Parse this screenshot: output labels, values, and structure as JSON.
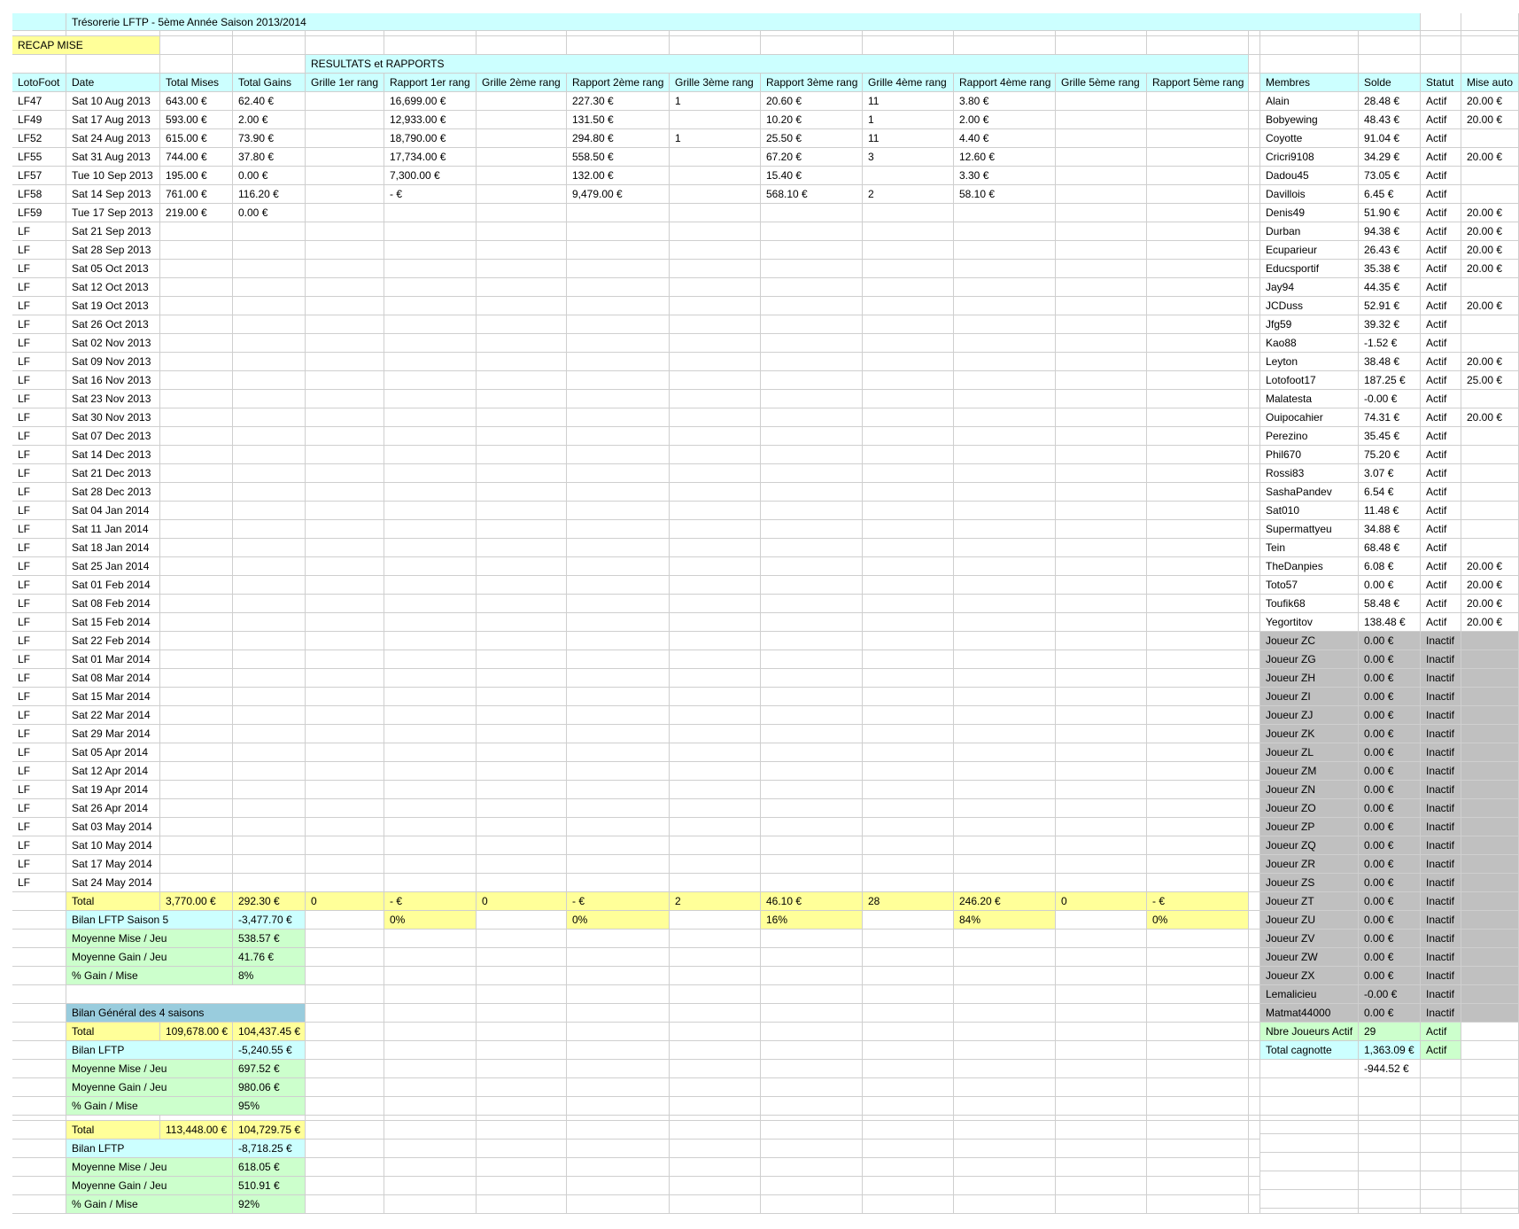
{
  "colors": {
    "cyan": "#ccffff",
    "yellow": "#ffff99",
    "green": "#ccffcc",
    "blue": "#99ccdd",
    "gray": "#c0c0c0",
    "white": "#ffffff",
    "grid": "#cfcfcf"
  },
  "title": "Trésorerie LFTP - 5ème Année Saison 2013/2014",
  "recap_label": "RECAP MISE",
  "results_label": "RESULTATS et RAPPORTS",
  "left_headers": [
    "LotoFoot",
    "Date",
    "Total Mises",
    "Total Gains",
    "Grille 1er rang",
    "Rapport 1er rang",
    "Grille 2ème rang",
    "Rapport 2ème rang",
    "Grille 3ème rang",
    "Rapport 3ème rang",
    "Grille 4ème rang",
    "Rapport 4ème rang",
    "Grille 5ème rang",
    "Rapport 5ème rang"
  ],
  "member_headers": [
    "Membres",
    "Solde",
    "Statut",
    "Mise auto"
  ],
  "games": [
    [
      "LF47",
      "Sat 10 Aug 2013",
      "643.00 €",
      "62.40 €",
      "",
      "16,699.00 €",
      "",
      "227.30 €",
      "1",
      "20.60 €",
      "11",
      "3.80 €",
      "",
      ""
    ],
    [
      "LF49",
      "Sat 17 Aug 2013",
      "593.00 €",
      "2.00 €",
      "",
      "12,933.00 €",
      "",
      "131.50 €",
      "",
      "10.20 €",
      "1",
      "2.00 €",
      "",
      ""
    ],
    [
      "LF52",
      "Sat 24 Aug 2013",
      "615.00 €",
      "73.90 €",
      "",
      "18,790.00 €",
      "",
      "294.80 €",
      "1",
      "25.50 €",
      "11",
      "4.40 €",
      "",
      ""
    ],
    [
      "LF55",
      "Sat 31 Aug 2013",
      "744.00 €",
      "37.80 €",
      "",
      "17,734.00 €",
      "",
      "558.50 €",
      "",
      "67.20 €",
      "3",
      "12.60 €",
      "",
      ""
    ],
    [
      "LF57",
      "Tue 10 Sep 2013",
      "195.00 €",
      "0.00 €",
      "",
      "7,300.00 €",
      "",
      "132.00 €",
      "",
      "15.40 €",
      "",
      "3.30 €",
      "",
      ""
    ],
    [
      "LF58",
      "Sat 14 Sep 2013",
      "761.00 €",
      "116.20 €",
      "",
      "- €",
      "",
      "9,479.00 €",
      "",
      "568.10 €",
      "2",
      "58.10 €",
      "",
      ""
    ],
    [
      "LF59",
      "Tue 17 Sep 2013",
      "219.00 €",
      "0.00 €",
      "",
      "",
      "",
      "",
      "",
      "",
      "",
      "",
      "",
      ""
    ],
    [
      "LF",
      "Sat 21 Sep 2013"
    ],
    [
      "LF",
      "Sat 28 Sep 2013"
    ],
    [
      "LF",
      "Sat 05 Oct 2013"
    ],
    [
      "LF",
      "Sat 12 Oct 2013"
    ],
    [
      "LF",
      "Sat 19 Oct 2013"
    ],
    [
      "LF",
      "Sat 26 Oct 2013"
    ],
    [
      "LF",
      "Sat 02 Nov 2013"
    ],
    [
      "LF",
      "Sat 09 Nov 2013"
    ],
    [
      "LF",
      "Sat 16 Nov 2013"
    ],
    [
      "LF",
      "Sat 23 Nov 2013"
    ],
    [
      "LF",
      "Sat 30 Nov 2013"
    ],
    [
      "LF",
      "Sat 07 Dec 2013"
    ],
    [
      "LF",
      "Sat 14 Dec 2013"
    ],
    [
      "LF",
      "Sat 21 Dec 2013"
    ],
    [
      "LF",
      "Sat 28 Dec 2013"
    ],
    [
      "LF",
      "Sat 04 Jan 2014"
    ],
    [
      "LF",
      "Sat 11 Jan 2014"
    ],
    [
      "LF",
      "Sat 18 Jan 2014"
    ],
    [
      "LF",
      "Sat 25 Jan 2014"
    ],
    [
      "LF",
      "Sat 01 Feb 2014"
    ],
    [
      "LF",
      "Sat 08 Feb 2014"
    ],
    [
      "LF",
      "Sat 15 Feb 2014"
    ],
    [
      "LF",
      "Sat 22 Feb 2014"
    ],
    [
      "LF",
      "Sat 01 Mar 2014"
    ],
    [
      "LF",
      "Sat 08 Mar 2014"
    ],
    [
      "LF",
      "Sat 15 Mar 2014"
    ],
    [
      "LF",
      "Sat 22 Mar 2014"
    ],
    [
      "LF",
      "Sat 29 Mar 2014"
    ],
    [
      "LF",
      "Sat 05 Apr 2014"
    ],
    [
      "LF",
      "Sat 12 Apr 2014"
    ],
    [
      "LF",
      "Sat 19 Apr 2014"
    ],
    [
      "LF",
      "Sat 26 Apr 2014"
    ],
    [
      "LF",
      "Sat 03 May 2014"
    ],
    [
      "LF",
      "Sat 10 May 2014"
    ],
    [
      "LF",
      "Sat 17 May 2014"
    ],
    [
      "LF",
      "Sat 24 May 2014"
    ]
  ],
  "total_row": [
    "",
    "Total",
    "3,770.00 €",
    "292.30 €",
    "0",
    "- €",
    "0",
    "- €",
    "2",
    "46.10 €",
    "28",
    "246.20 €",
    "0",
    "- €"
  ],
  "pct_row": [
    "",
    "Bilan LFTP Saison 5",
    "",
    "-3,477.70 €",
    "",
    "0%",
    "",
    "0%",
    "",
    "16%",
    "",
    "84%",
    "",
    "0%"
  ],
  "season_summary": [
    {
      "label": "Moyenne Mise / Jeu",
      "value": "538.57 €"
    },
    {
      "label": "Moyenne Gain / Jeu",
      "value": "41.76 €"
    },
    {
      "label": "% Gain / Mise",
      "value": "8%"
    }
  ],
  "bilan_general": {
    "title": "Bilan Général des 4 saisons",
    "total_label": "Total",
    "total_mises": "109,678.00 €",
    "total_gains": "104,437.45 €",
    "bilan_label": "Bilan LFTP",
    "bilan_value": "-5,240.55 €",
    "rows": [
      {
        "label": "Moyenne Mise / Jeu",
        "value": "697.52 €"
      },
      {
        "label": "Moyenne Gain / Jeu",
        "value": "980.06 €"
      },
      {
        "label": "% Gain / Mise",
        "value": "95%"
      }
    ]
  },
  "bilan_all": {
    "total_label": "Total",
    "total_mises": "113,448.00 €",
    "total_gains": "104,729.75 €",
    "bilan_label": "Bilan LFTP",
    "bilan_value": "-8,718.25 €",
    "rows": [
      {
        "label": "Moyenne Mise / Jeu",
        "value": "618.05 €"
      },
      {
        "label": "Moyenne Gain / Jeu",
        "value": "510.91 €"
      },
      {
        "label": "% Gain / Mise",
        "value": "92%"
      }
    ]
  },
  "members": [
    [
      "Alain",
      "28.48 €",
      "Actif",
      "20.00 €"
    ],
    [
      "Bobyewing",
      "48.43 €",
      "Actif",
      "20.00 €"
    ],
    [
      "Coyotte",
      "91.04 €",
      "Actif",
      ""
    ],
    [
      "Cricri9108",
      "34.29 €",
      "Actif",
      "20.00 €"
    ],
    [
      "Dadou45",
      "73.05 €",
      "Actif",
      ""
    ],
    [
      "Davillois",
      "6.45 €",
      "Actif",
      ""
    ],
    [
      "Denis49",
      "51.90 €",
      "Actif",
      "20.00 €"
    ],
    [
      "Durban",
      "94.38 €",
      "Actif",
      "20.00 €"
    ],
    [
      "Ecuparieur",
      "26.43 €",
      "Actif",
      "20.00 €"
    ],
    [
      "Educsportif",
      "35.38 €",
      "Actif",
      "20.00 €"
    ],
    [
      "Jay94",
      "44.35 €",
      "Actif",
      ""
    ],
    [
      "JCDuss",
      "52.91 €",
      "Actif",
      "20.00 €"
    ],
    [
      "Jfg59",
      "39.32 €",
      "Actif",
      ""
    ],
    [
      "Kao88",
      "-1.52 €",
      "Actif",
      ""
    ],
    [
      "Leyton",
      "38.48 €",
      "Actif",
      "20.00 €"
    ],
    [
      "Lotofoot17",
      "187.25 €",
      "Actif",
      "25.00 €"
    ],
    [
      "Malatesta",
      "-0.00 €",
      "Actif",
      ""
    ],
    [
      "Ouipocahier",
      "74.31 €",
      "Actif",
      "20.00 €"
    ],
    [
      "Perezino",
      "35.45 €",
      "Actif",
      ""
    ],
    [
      "Phil670",
      "75.20 €",
      "Actif",
      ""
    ],
    [
      "Rossi83",
      "3.07 €",
      "Actif",
      ""
    ],
    [
      "SashaPandev",
      "6.54 €",
      "Actif",
      ""
    ],
    [
      "Sat010",
      "11.48 €",
      "Actif",
      ""
    ],
    [
      "Supermattyeu",
      "34.88 €",
      "Actif",
      ""
    ],
    [
      "Tein",
      "68.48 €",
      "Actif",
      ""
    ],
    [
      "TheDanpies",
      "6.08 €",
      "Actif",
      "20.00 €"
    ],
    [
      "Toto57",
      "0.00 €",
      "Actif",
      "20.00 €"
    ],
    [
      "Toufik68",
      "58.48 €",
      "Actif",
      "20.00 €"
    ],
    [
      "Yegortitov",
      "138.48 €",
      "Actif",
      "20.00 €"
    ],
    [
      "Joueur ZC",
      "0.00 €",
      "Inactif",
      ""
    ],
    [
      "Joueur ZG",
      "0.00 €",
      "Inactif",
      ""
    ],
    [
      "Joueur ZH",
      "0.00 €",
      "Inactif",
      ""
    ],
    [
      "Joueur ZI",
      "0.00 €",
      "Inactif",
      ""
    ],
    [
      "Joueur ZJ",
      "0.00 €",
      "Inactif",
      ""
    ],
    [
      "Joueur ZK",
      "0.00 €",
      "Inactif",
      ""
    ],
    [
      "Joueur ZL",
      "0.00 €",
      "Inactif",
      ""
    ],
    [
      "Joueur ZM",
      "0.00 €",
      "Inactif",
      ""
    ],
    [
      "Joueur ZN",
      "0.00 €",
      "Inactif",
      ""
    ],
    [
      "Joueur ZO",
      "0.00 €",
      "Inactif",
      ""
    ],
    [
      "Joueur ZP",
      "0.00 €",
      "Inactif",
      ""
    ],
    [
      "Joueur ZQ",
      "0.00 €",
      "Inactif",
      ""
    ],
    [
      "Joueur ZR",
      "0.00 €",
      "Inactif",
      ""
    ],
    [
      "Joueur ZS",
      "0.00 €",
      "Inactif",
      ""
    ],
    [
      "Joueur ZT",
      "0.00 €",
      "Inactif",
      ""
    ],
    [
      "Joueur ZU",
      "0.00 €",
      "Inactif",
      ""
    ],
    [
      "Joueur ZV",
      "0.00 €",
      "Inactif",
      ""
    ],
    [
      "Joueur ZW",
      "0.00 €",
      "Inactif",
      ""
    ],
    [
      "Joueur ZX",
      "0.00 €",
      "Inactif",
      ""
    ],
    [
      "Lemalicieu",
      "-0.00 €",
      "Inactif",
      ""
    ],
    [
      "Matmat44000",
      "0.00 €",
      "Inactif",
      ""
    ]
  ],
  "member_summary": [
    {
      "label": "Nbre Joueurs Actif",
      "value": "29",
      "status": "Actif"
    },
    {
      "label": "Total cagnotte",
      "value": "1,363.09 €",
      "status": "Actif"
    }
  ],
  "extra_value": "-944.52 €"
}
